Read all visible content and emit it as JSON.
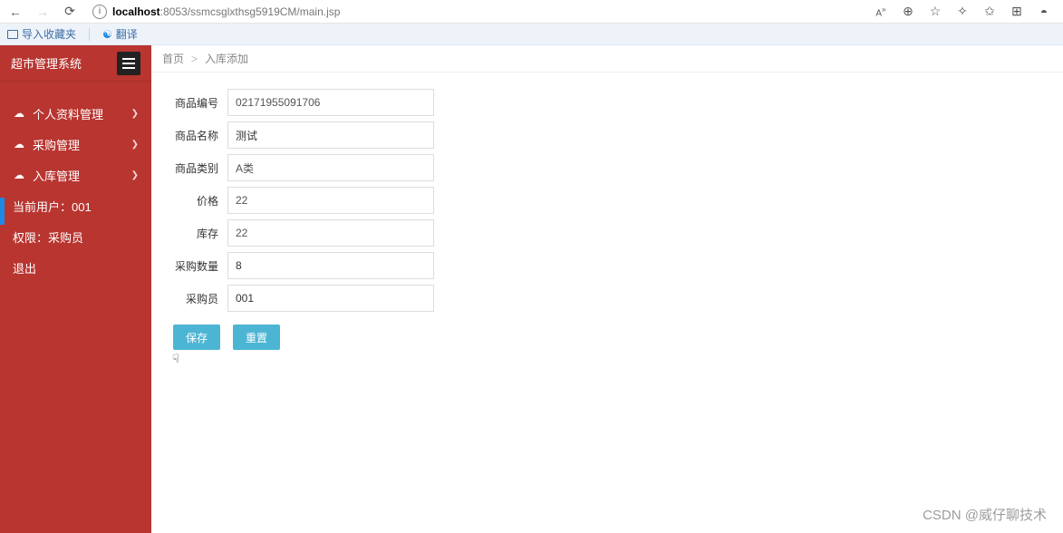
{
  "browser": {
    "url_host": "localhost",
    "url_port_path": ":8053/ssmcsglxthsg5919CM/main.jsp",
    "text_size_label": "A",
    "icons": {
      "back": "←",
      "forward": "→",
      "refresh": "⟳",
      "zoom": "⊕",
      "star": "☆",
      "ext": "⌘",
      "fav2": "⧉",
      "collections": "⊞",
      "profile": "👤"
    }
  },
  "toolbar": {
    "import_fav": "导入收藏夹",
    "translate": "翻译"
  },
  "sidebar": {
    "title": "超市管理系统",
    "items": [
      {
        "icon": "☁",
        "label": "个人资料管理"
      },
      {
        "icon": "☁",
        "label": "采购管理"
      },
      {
        "icon": "☁",
        "label": "入库管理"
      }
    ],
    "current_user_label": "当前用户：001",
    "role_label": "权限：采购员",
    "logout": "退出"
  },
  "breadcrumb": {
    "home": "首页",
    "current": "入库添加"
  },
  "form": {
    "fields": [
      {
        "label": "商品编号",
        "value": "02171955091706",
        "readonly": true
      },
      {
        "label": "商品名称",
        "value": "测试",
        "readonly": false
      },
      {
        "label": "商品类别",
        "value": "A类",
        "readonly": true
      },
      {
        "label": "价格",
        "value": "22",
        "readonly": true
      },
      {
        "label": "库存",
        "value": "22",
        "readonly": true
      },
      {
        "label": "采购数量",
        "value": "8",
        "readonly": false
      },
      {
        "label": "采购员",
        "value": "001",
        "readonly": false
      }
    ],
    "save_label": "保存",
    "reset_label": "重置"
  },
  "watermark": "CSDN @威仔聊技术"
}
